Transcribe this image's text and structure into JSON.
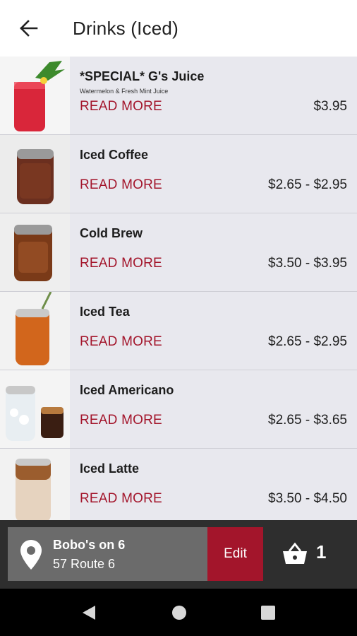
{
  "header": {
    "title": "Drinks (Iced)"
  },
  "items": [
    {
      "name": "*SPECIAL* G's Juice",
      "description": "Watermelon & Fresh Mint Juice",
      "more": "READ MORE",
      "price": "$3.95"
    },
    {
      "name": "Iced Coffee",
      "more": "READ MORE",
      "price": "$2.65 - $2.95"
    },
    {
      "name": "Cold Brew",
      "more": "READ MORE",
      "price": "$3.50 - $3.95"
    },
    {
      "name": "Iced Tea",
      "more": "READ MORE",
      "price": "$2.65 - $2.95"
    },
    {
      "name": "Iced Americano",
      "more": "READ MORE",
      "price": "$2.65 - $3.65"
    },
    {
      "name": "Iced Latte",
      "more": "READ MORE",
      "price": "$3.50 - $4.50"
    }
  ],
  "footer": {
    "store_name": "Bobo's on 6",
    "store_address": "57 Route 6",
    "edit_label": "Edit",
    "cart_count": "1"
  },
  "colors": {
    "accent": "#a3152b",
    "list_bg": "#e8e8ee",
    "bottom_bar": "#2e2e2e",
    "location_bg": "#6b6b6b"
  },
  "icons": [
    "back-arrow-icon",
    "location-pin-icon",
    "cart-basket-icon",
    "nav-back-icon",
    "nav-home-icon",
    "nav-recents-icon"
  ]
}
